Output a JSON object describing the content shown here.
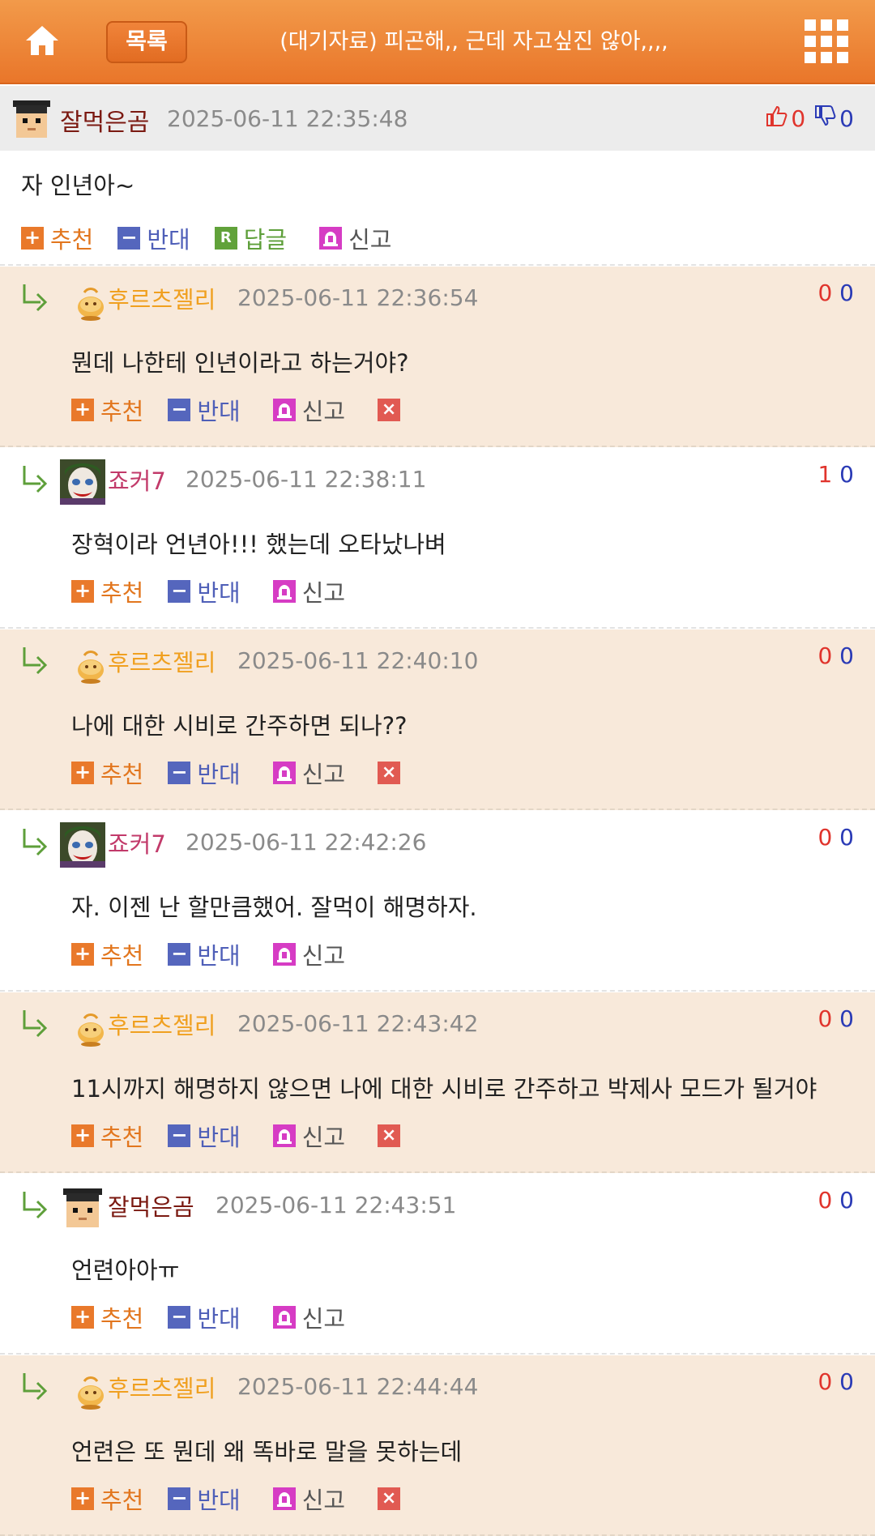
{
  "header": {
    "list_label": "목록",
    "title": "(대기자료) 피곤해,, 근데 자고싶진 않아,,,,"
  },
  "post": {
    "author": "잘먹은곰",
    "date": "2025-06-11 22:35:48",
    "up": "0",
    "down": "0",
    "text": "자 인년아~",
    "actions": {
      "recommend": "추천",
      "oppose": "반대",
      "reply": "답글",
      "report": "신고"
    }
  },
  "labels": {
    "recommend": "추천",
    "oppose": "반대",
    "report": "신고",
    "plus": "+",
    "minus": "−",
    "reply_icon": "R",
    "delete": "×"
  },
  "comments": [
    {
      "author": "후르츠젤리",
      "date": "2025-06-11 22:36:54",
      "up": "0",
      "down": "0",
      "text": "뭔데 나한테 인년이라고 하는거야?"
    },
    {
      "author": "죠커7",
      "date": "2025-06-11 22:38:11",
      "up": "1",
      "down": "0",
      "text": "장혁이라 언년아!!! 했는데 오타났나벼"
    },
    {
      "author": "후르츠젤리",
      "date": "2025-06-11 22:40:10",
      "up": "0",
      "down": "0",
      "text": "나에 대한 시비로 간주하면 되나??"
    },
    {
      "author": "죠커7",
      "date": "2025-06-11 22:42:26",
      "up": "0",
      "down": "0",
      "text": "자. 이젠 난 할만큼했어. 잘먹이 해명하자."
    },
    {
      "author": "후르츠젤리",
      "date": "2025-06-11 22:43:42",
      "up": "0",
      "down": "0",
      "text": "11시까지 해명하지 않으면 나에 대한 시비로 간주하고 박제사 모드가 될거야"
    },
    {
      "author": "잘먹은곰",
      "date": "2025-06-11 22:43:51",
      "up": "0",
      "down": "0",
      "text": "언련아아ㅠ"
    },
    {
      "author": "후르츠젤리",
      "date": "2025-06-11 22:44:44",
      "up": "0",
      "down": "0",
      "text": "언련은 또 뭔데 왜 똑바로 말을 못하는데"
    }
  ],
  "colors": {
    "header": "#e9762a",
    "peach_row": "#f8e9da",
    "recommend": "#e9792b",
    "oppose": "#5566bd"
  }
}
